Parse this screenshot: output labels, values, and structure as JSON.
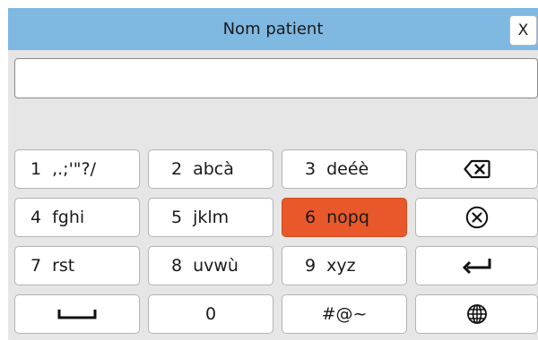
{
  "dialog": {
    "title": "Nom patient",
    "close_label": "X",
    "input_value": "",
    "input_placeholder": ""
  },
  "keyboard": {
    "key1": {
      "num": "1",
      "chars": ",.;'\"?/"
    },
    "key2": {
      "num": "2",
      "chars": "abcà"
    },
    "key3": {
      "num": "3",
      "chars": "deéè"
    },
    "key4": {
      "num": "4",
      "chars": "fghi"
    },
    "key5": {
      "num": "5",
      "chars": "jklm"
    },
    "key6": {
      "num": "6",
      "chars": "nopq"
    },
    "key7": {
      "num": "7",
      "chars": "rst"
    },
    "key8": {
      "num": "8",
      "chars": "uvwù"
    },
    "key9": {
      "num": "9",
      "chars": "xyz"
    },
    "key0": {
      "num": "0"
    },
    "symbols_label": "#@~",
    "active_key": "6",
    "icons": {
      "backspace": "backspace-icon",
      "clear": "clear-circle-icon",
      "enter": "enter-icon",
      "space": "space-icon",
      "language": "globe-icon"
    }
  },
  "colors": {
    "title_bar": "#7fb8e0",
    "active_key": "#e8582a",
    "background": "#e6e6e6"
  }
}
